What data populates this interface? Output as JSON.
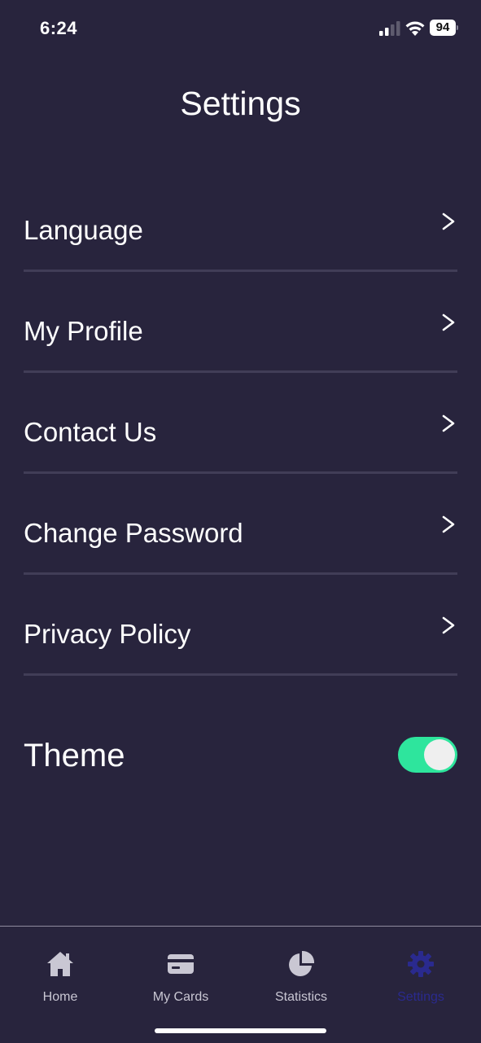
{
  "status_bar": {
    "time": "6:24",
    "battery": "94"
  },
  "header": {
    "title": "Settings"
  },
  "settings": {
    "items": [
      {
        "label": "Language"
      },
      {
        "label": "My Profile"
      },
      {
        "label": "Contact Us"
      },
      {
        "label": "Change Password"
      },
      {
        "label": "Privacy Policy"
      }
    ],
    "chevron": ">",
    "theme": {
      "label": "Theme",
      "enabled": true
    }
  },
  "tab_bar": {
    "tabs": [
      {
        "label": "Home",
        "icon": "home-icon"
      },
      {
        "label": "My Cards",
        "icon": "card-icon"
      },
      {
        "label": "Statistics",
        "icon": "pie-chart-icon"
      },
      {
        "label": "Settings",
        "icon": "gear-icon",
        "active": true
      }
    ]
  },
  "colors": {
    "background": "#28243d",
    "divider": "#413d57",
    "toggle_on": "#2ee59d",
    "tab_inactive": "#c9c7d3",
    "tab_active": "#2a2a8e"
  }
}
